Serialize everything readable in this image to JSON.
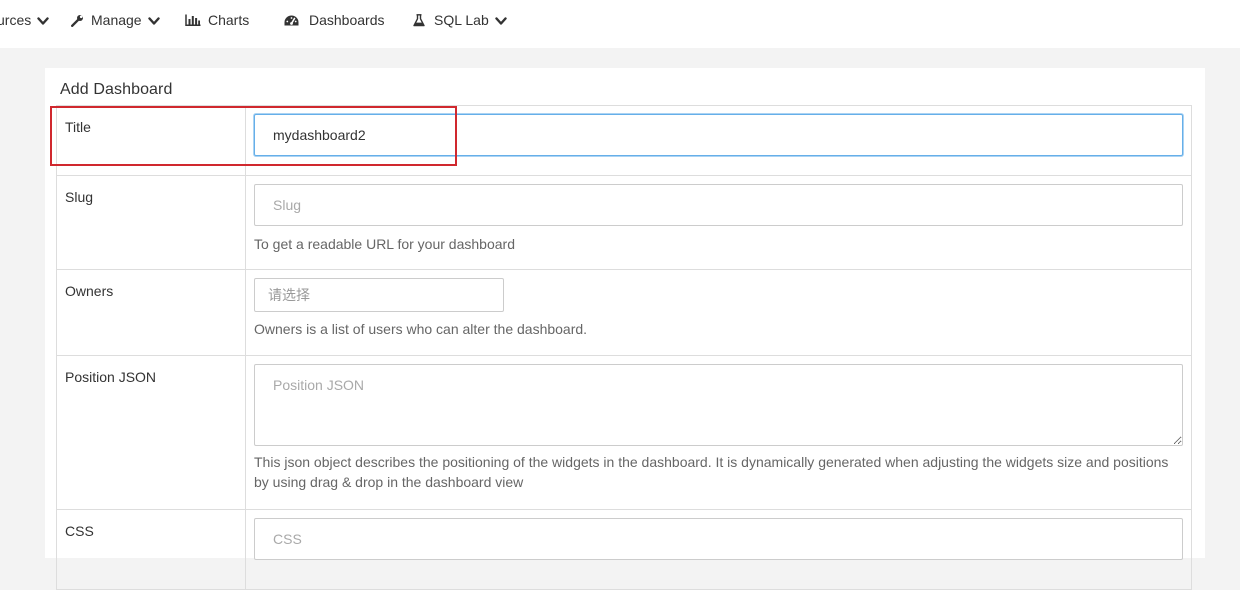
{
  "nav": {
    "items": [
      {
        "label": "urces",
        "icon": "database-icon",
        "has_dropdown": true
      },
      {
        "label": "Manage",
        "icon": "wrench-icon",
        "has_dropdown": true
      },
      {
        "label": "Charts",
        "icon": "bar-chart-icon",
        "has_dropdown": false
      },
      {
        "label": "Dashboards",
        "icon": "dashboard-gauge-icon",
        "has_dropdown": false
      },
      {
        "label": "SQL Lab",
        "icon": "flask-icon",
        "has_dropdown": true
      }
    ]
  },
  "form": {
    "title": "Add Dashboard",
    "fields": {
      "title": {
        "label": "Title",
        "value": "mydashboard2",
        "placeholder": ""
      },
      "slug": {
        "label": "Slug",
        "value": "",
        "placeholder": "Slug",
        "help": "To get a readable URL for your dashboard"
      },
      "owners": {
        "label": "Owners",
        "placeholder": "请选择",
        "help": "Owners is a list of users who can alter the dashboard."
      },
      "position_json": {
        "label": "Position JSON",
        "value": "",
        "placeholder": "Position JSON",
        "help": "This json object describes the positioning of the widgets in the dashboard. It is dynamically generated when adjusting the widgets size and positions by using drag & drop in the dashboard view"
      },
      "css": {
        "label": "CSS",
        "value": "",
        "placeholder": "CSS"
      }
    }
  },
  "colors": {
    "highlight": "#d0282e",
    "focus": "#66afe9",
    "background": "#f3f3f3"
  }
}
